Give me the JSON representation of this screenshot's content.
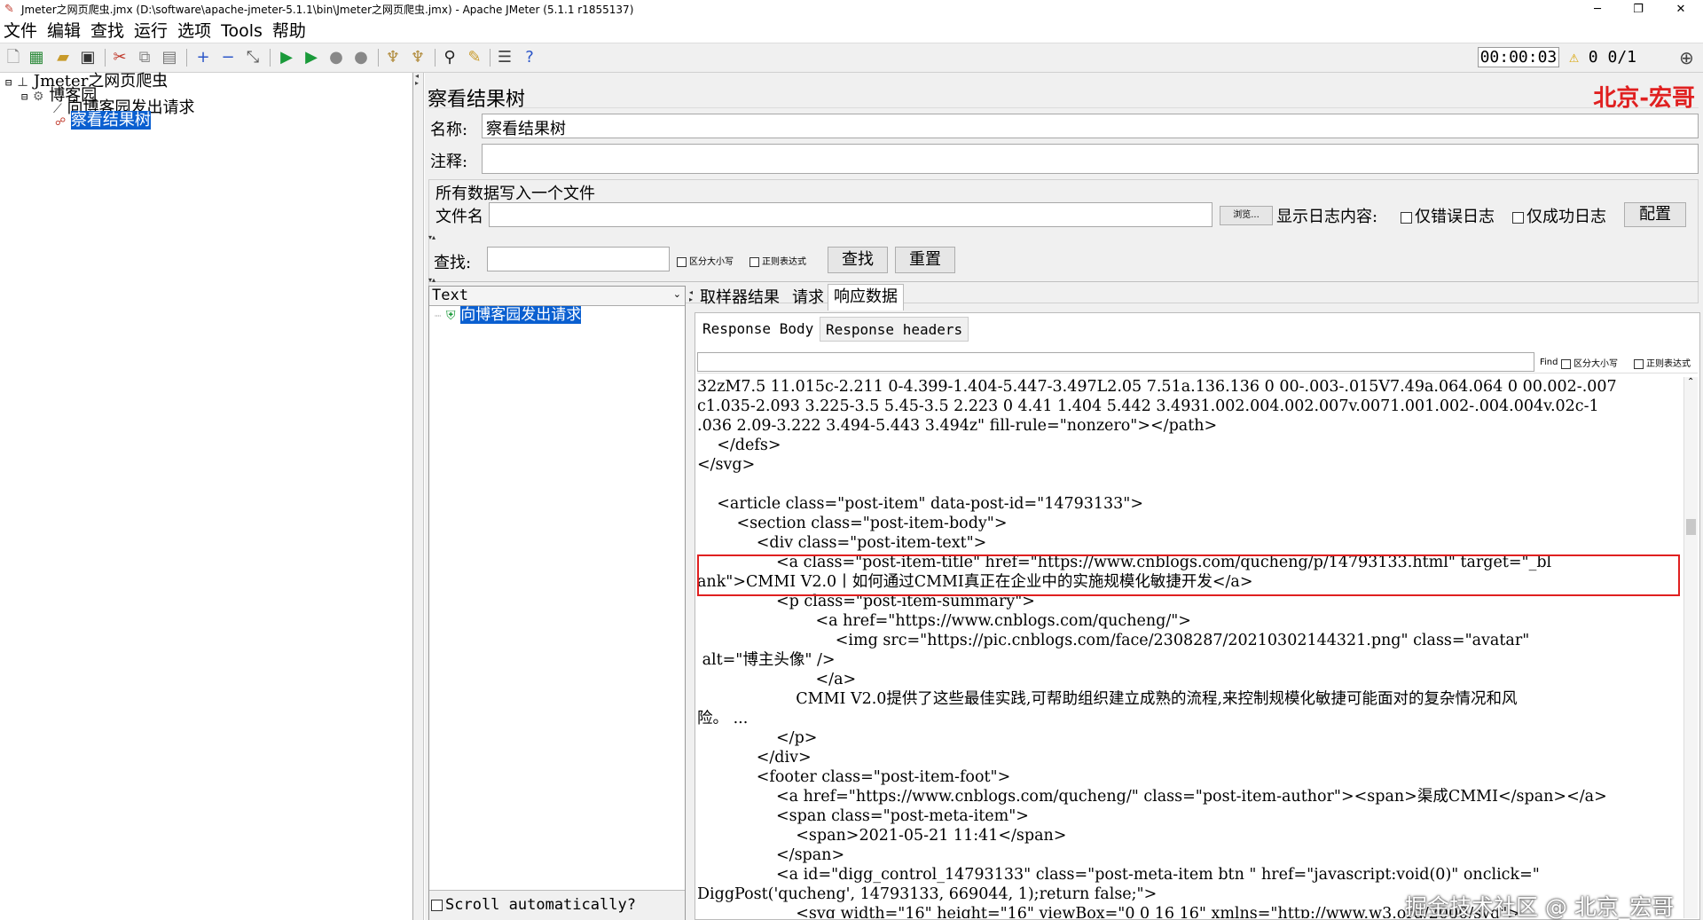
{
  "window": {
    "title": "Jmeter之网页爬虫.jmx (D:\\software\\apache-jmeter-5.1.1\\bin\\Jmeter之网页爬虫.jmx) - Apache JMeter (5.1.1 r1855137)",
    "minimize": "─",
    "restore": "❐",
    "close": "✕"
  },
  "menu": [
    "文件",
    "编辑",
    "查找",
    "运行",
    "选项",
    "Tools",
    "帮助"
  ],
  "status": {
    "elapsed": "00:00:03",
    "warnings": "0",
    "threads": "0/1"
  },
  "tree": {
    "root": "Jmeter之网页爬虫",
    "thread_group": "博客园",
    "sampler": "向博客园发出请求",
    "listener": "察看结果树"
  },
  "panel": {
    "title": "察看结果树",
    "watermark": "北京-宏哥",
    "name_label": "名称:",
    "name_value": "察看结果树",
    "comment_label": "注释:",
    "comment_value": "",
    "file_section": "所有数据写入一个文件",
    "filename_label": "文件名",
    "filename_value": "",
    "browse": "浏览...",
    "log_label": "显示日志内容:",
    "errors_only": "仅错误日志",
    "success_only": "仅成功日志",
    "configure": "配置"
  },
  "search": {
    "label": "查找:",
    "value": "",
    "case": "区分大小写",
    "regex": "正则表达式",
    "find": "查找",
    "reset": "重置"
  },
  "results": {
    "renderer": "Text",
    "sample": "向博客园发出请求",
    "scroll": "Scroll automatically?"
  },
  "tabs": [
    "取样器结果",
    "请求",
    "响应数据"
  ],
  "subtabs": [
    "Response Body",
    "Response headers"
  ],
  "find": {
    "label": "Find",
    "case": "区分大小写",
    "regex": "正则表达式"
  },
  "response_lines": [
    "32zM7.5 11.015c-2.211 0-4.399-1.404-5.447-3.497L2.05 7.51a.136.136 0 00-.003-.015V7.49a.064.064 0 00.002-.007",
    "c1.035-2.093 3.225-3.5 5.45-3.5 2.223 0 4.41 1.404 5.442 3.4931.002.004.002.007v.0071.001.002-.004.004v.02c-1",
    ".036 2.09-3.222 3.494-5.443 3.494z\" fill-rule=\"nonzero\"></path>",
    "    </defs>",
    "</svg>",
    "",
    "    <article class=\"post-item\" data-post-id=\"14793133\">",
    "        <section class=\"post-item-body\">",
    "            <div class=\"post-item-text\">",
    "                <a class=\"post-item-title\" href=\"https://www.cnblogs.com/qucheng/p/14793133.html\" target=\"_bl",
    "ank\">CMMI V2.0丨如何通过CMMI真正在企业中的实施规模化敏捷开发</a>",
    "                <p class=\"post-item-summary\">",
    "                        <a href=\"https://www.cnblogs.com/qucheng/\">",
    "                            <img src=\"https://pic.cnblogs.com/face/2308287/20210302144321.png\" class=\"avatar\"",
    " alt=\"博主头像\" />",
    "                        </a>",
    "                    CMMI V2.0提供了这些最佳实践,可帮助组织建立成熟的流程,来控制规模化敏捷可能面对的复杂情况和风",
    "险。 ...",
    "                </p>",
    "            </div>",
    "            <footer class=\"post-item-foot\">",
    "                <a href=\"https://www.cnblogs.com/qucheng/\" class=\"post-item-author\"><span>渠成CMMI</span></a>",
    "                <span class=\"post-meta-item\">",
    "                    <span>2021-05-21 11:41</span>",
    "                </span>",
    "                <a id=\"digg_control_14793133\" class=\"post-meta-item btn \" href=\"javascript:void(0)\" onclick=\"",
    "DiggPost('qucheng', 14793133, 669044, 1);return false;\">",
    "                    <svg width=\"16\" height=\"16\" viewBox=\"0 0 16 16\" xmlns=\"http://www.w3.org/2000/svg\">"
  ],
  "footer_watermark": "掘金技术社区 @ 北京_宏哥",
  "colors": {
    "selection": "#0a5fd0",
    "highlight_box": "#e02020",
    "watermark": "#e02020"
  }
}
